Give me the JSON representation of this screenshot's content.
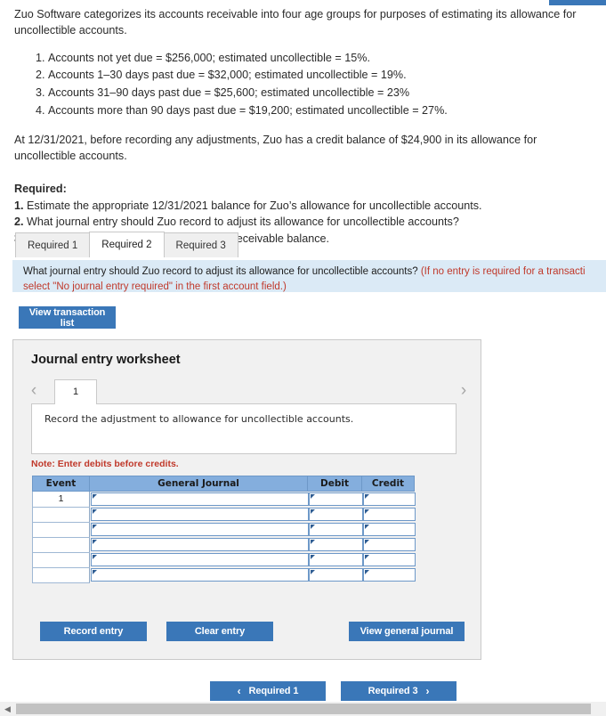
{
  "problem": {
    "intro": "Zuo Software categorizes its accounts receivable into four age groups for purposes of estimating its allowance for uncollectible accounts.",
    "age_groups": [
      "Accounts not yet due = $256,000; estimated uncollectible = 15%.",
      "Accounts 1–30 days past due = $32,000; estimated uncollectible = 19%.",
      "Accounts 31–90 days past due = $25,600; estimated uncollectible = 23%",
      "Accounts more than 90 days past due = $19,200; estimated uncollectible = 27%."
    ],
    "balance_note": "At 12/31/2021, before recording any adjustments, Zuo has a credit balance of $24,900 in its allowance for uncollectible accounts.",
    "required_label": "Required:",
    "requirements": [
      {
        "num": "1.",
        "text": "Estimate the appropriate 12/31/2021 balance for Zuo’s allowance for uncollectible accounts."
      },
      {
        "num": "2.",
        "text": "What journal entry should Zuo record to adjust its allowance for uncollectible accounts?"
      },
      {
        "num": "3.",
        "text": "Calculate Zuo’s 12/31/2021 net accounts receivable balance."
      }
    ]
  },
  "tabs": [
    {
      "label": "Required 1",
      "active": false
    },
    {
      "label": "Required 2",
      "active": true
    },
    {
      "label": "Required 3",
      "active": false
    }
  ],
  "instruction": {
    "line1_main": "What journal entry should Zuo record to adjust its allowance for uncollectible accounts? ",
    "line1_hint": "(If no entry is required for a transacti",
    "line2_hint": "select \"No journal entry required\" in the first account field.)"
  },
  "buttons": {
    "view_transaction_list": "View transaction list",
    "record_entry": "Record entry",
    "clear_entry": "Clear entry",
    "view_general_journal": "View general journal"
  },
  "worksheet": {
    "title": "Journal entry worksheet",
    "prev_icon": "chevron-left-icon",
    "next_icon": "chevron-right-icon",
    "page_tab": "1",
    "description": "Record the adjustment to allowance for uncollectible accounts.",
    "note": "Note: Enter debits before credits.",
    "table": {
      "headers": [
        "Event",
        "General Journal",
        "Debit",
        "Credit"
      ],
      "rows": [
        {
          "event": "1",
          "general_journal": "",
          "debit": "",
          "credit": ""
        },
        {
          "event": "",
          "general_journal": "",
          "debit": "",
          "credit": ""
        },
        {
          "event": "",
          "general_journal": "",
          "debit": "",
          "credit": ""
        },
        {
          "event": "",
          "general_journal": "",
          "debit": "",
          "credit": ""
        },
        {
          "event": "",
          "general_journal": "",
          "debit": "",
          "credit": ""
        },
        {
          "event": "",
          "general_journal": "",
          "debit": "",
          "credit": ""
        }
      ]
    }
  },
  "bottom_nav": {
    "prev_icon": "chevron-left-icon",
    "prev_label": "Required 1",
    "next_label": "Required 3",
    "next_icon": "chevron-right-icon"
  },
  "scrollbar": {
    "left_arrow_icon": "triangle-left-icon"
  },
  "colors": {
    "accent_blue": "#3A77B8",
    "table_header_blue": "#84aedd",
    "banner_blue": "#dbeaf6",
    "hint_red": "#c0392b",
    "panel_gray": "#f1f1f1"
  }
}
